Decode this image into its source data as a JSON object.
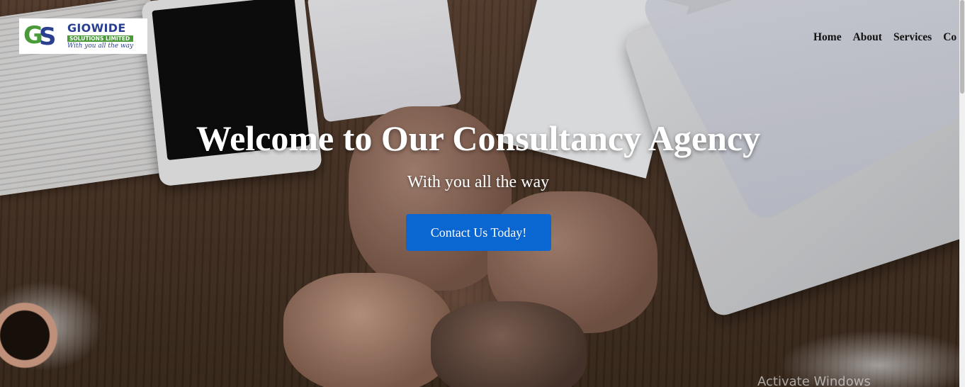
{
  "header": {
    "logo": {
      "mark_letters": [
        "G",
        "S"
      ],
      "title": "GIOWIDE",
      "subtitle": "SOLUTIONS LIMITED",
      "tagline": "With you all the way"
    },
    "nav": {
      "items": [
        "Home",
        "About",
        "Services",
        "Co"
      ]
    }
  },
  "hero": {
    "title": "Welcome to Our Consultancy Agency",
    "subtitle": "With you all the way",
    "cta_label": "Contact Us Today!"
  },
  "system": {
    "watermark": "Activate Windows"
  },
  "colors": {
    "cta": "#0a66d1",
    "logo_green": "#4a9a3a",
    "logo_blue": "#2b3f8f"
  }
}
